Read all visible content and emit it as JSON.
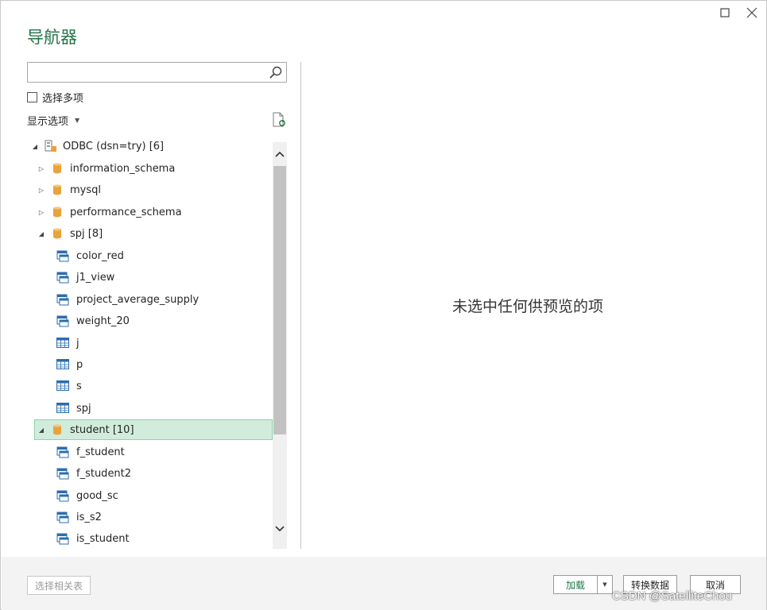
{
  "window": {
    "title": "导航器",
    "maximize_icon": "maximize-icon",
    "close_icon": "close-icon"
  },
  "search": {
    "value": "",
    "placeholder": "",
    "icon": "search-icon"
  },
  "multi_select": {
    "label": "选择多项",
    "checked": false
  },
  "display_options": {
    "label": "显示选项",
    "refresh_icon": "refresh-icon"
  },
  "tree": {
    "root": {
      "label": "ODBC (dsn=try) [6]",
      "expanded": true,
      "icon": "odbc-source-icon"
    },
    "items": [
      {
        "label": "information_schema",
        "type": "database",
        "expanded": false
      },
      {
        "label": "mysql",
        "type": "database",
        "expanded": false
      },
      {
        "label": "performance_schema",
        "type": "database",
        "expanded": false
      },
      {
        "label": "spj [8]",
        "type": "database",
        "expanded": true
      },
      {
        "label": "color_red",
        "type": "view"
      },
      {
        "label": "j1_view",
        "type": "view"
      },
      {
        "label": "project_average_supply",
        "type": "view"
      },
      {
        "label": "weight_20",
        "type": "view"
      },
      {
        "label": "j",
        "type": "table"
      },
      {
        "label": "p",
        "type": "table"
      },
      {
        "label": "s",
        "type": "table"
      },
      {
        "label": "spj",
        "type": "table"
      },
      {
        "label": "student [10]",
        "type": "database",
        "expanded": true,
        "selected": true
      },
      {
        "label": "f_student",
        "type": "view"
      },
      {
        "label": "f_student2",
        "type": "view"
      },
      {
        "label": "good_sc",
        "type": "view"
      },
      {
        "label": "is_s2",
        "type": "view"
      },
      {
        "label": "is_student",
        "type": "view"
      }
    ]
  },
  "preview": {
    "empty_message": "未选中任何供预览的项"
  },
  "footer": {
    "select_related_label": "选择相关表",
    "load_label": "加载",
    "transform_label": "转换数据",
    "cancel_label": "取消"
  },
  "watermark": "CSDN @SatelliteChou",
  "colors": {
    "accent": "#217346",
    "selected_bg": "#d1ecdc",
    "selected_border": "#8fd3aa",
    "database_icon": "#e8a33d",
    "view_icon": "#2b6cb0"
  }
}
